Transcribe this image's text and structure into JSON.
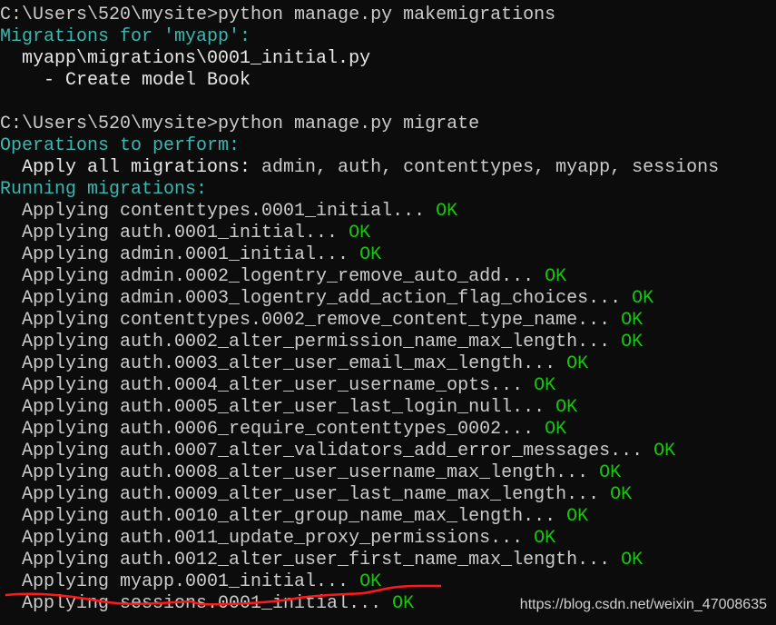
{
  "terminal": {
    "lines": [
      [
        {
          "t": "C:\\Users\\520\\mysite>python manage.py makemigrations",
          "c": "normal"
        }
      ],
      [
        {
          "t": "Migrations for 'myapp':",
          "c": "cyan"
        }
      ],
      [
        {
          "t": "  myapp\\migrations\\0001_initial.py",
          "c": "bold"
        }
      ],
      [
        {
          "t": "    - Create model Book",
          "c": "bold"
        }
      ],
      [
        {
          "t": "",
          "c": "normal"
        }
      ],
      [
        {
          "t": "C:\\Users\\520\\mysite>python manage.py migrate",
          "c": "normal"
        }
      ],
      [
        {
          "t": "Operations to perform:",
          "c": "cyan"
        }
      ],
      [
        {
          "t": "  Apply all migrations: ",
          "c": "bold"
        },
        {
          "t": "admin, auth, contenttypes, myapp, sessions",
          "c": "normal"
        }
      ],
      [
        {
          "t": "Running migrations:",
          "c": "cyan"
        }
      ],
      [
        {
          "t": "  Applying contenttypes.0001_initial... ",
          "c": "normal"
        },
        {
          "t": "OK",
          "c": "green"
        }
      ],
      [
        {
          "t": "  Applying auth.0001_initial... ",
          "c": "normal"
        },
        {
          "t": "OK",
          "c": "green"
        }
      ],
      [
        {
          "t": "  Applying admin.0001_initial... ",
          "c": "normal"
        },
        {
          "t": "OK",
          "c": "green"
        }
      ],
      [
        {
          "t": "  Applying admin.0002_logentry_remove_auto_add... ",
          "c": "normal"
        },
        {
          "t": "OK",
          "c": "green"
        }
      ],
      [
        {
          "t": "  Applying admin.0003_logentry_add_action_flag_choices... ",
          "c": "normal"
        },
        {
          "t": "OK",
          "c": "green"
        }
      ],
      [
        {
          "t": "  Applying contenttypes.0002_remove_content_type_name... ",
          "c": "normal"
        },
        {
          "t": "OK",
          "c": "green"
        }
      ],
      [
        {
          "t": "  Applying auth.0002_alter_permission_name_max_length... ",
          "c": "normal"
        },
        {
          "t": "OK",
          "c": "green"
        }
      ],
      [
        {
          "t": "  Applying auth.0003_alter_user_email_max_length... ",
          "c": "normal"
        },
        {
          "t": "OK",
          "c": "green"
        }
      ],
      [
        {
          "t": "  Applying auth.0004_alter_user_username_opts... ",
          "c": "normal"
        },
        {
          "t": "OK",
          "c": "green"
        }
      ],
      [
        {
          "t": "  Applying auth.0005_alter_user_last_login_null... ",
          "c": "normal"
        },
        {
          "t": "OK",
          "c": "green"
        }
      ],
      [
        {
          "t": "  Applying auth.0006_require_contenttypes_0002... ",
          "c": "normal"
        },
        {
          "t": "OK",
          "c": "green"
        }
      ],
      [
        {
          "t": "  Applying auth.0007_alter_validators_add_error_messages... ",
          "c": "normal"
        },
        {
          "t": "OK",
          "c": "green"
        }
      ],
      [
        {
          "t": "  Applying auth.0008_alter_user_username_max_length... ",
          "c": "normal"
        },
        {
          "t": "OK",
          "c": "green"
        }
      ],
      [
        {
          "t": "  Applying auth.0009_alter_user_last_name_max_length... ",
          "c": "normal"
        },
        {
          "t": "OK",
          "c": "green"
        }
      ],
      [
        {
          "t": "  Applying auth.0010_alter_group_name_max_length... ",
          "c": "normal"
        },
        {
          "t": "OK",
          "c": "green"
        }
      ],
      [
        {
          "t": "  Applying auth.0011_update_proxy_permissions... ",
          "c": "normal"
        },
        {
          "t": "OK",
          "c": "green"
        }
      ],
      [
        {
          "t": "  Applying auth.0012_alter_user_first_name_max_length... ",
          "c": "normal"
        },
        {
          "t": "OK",
          "c": "green"
        }
      ],
      [
        {
          "t": "  Applying myapp.0001_initial... ",
          "c": "normal"
        },
        {
          "t": "OK",
          "c": "green"
        }
      ],
      [
        {
          "t": "  Applying sessions.0001_initial... ",
          "c": "normal"
        },
        {
          "t": "OK",
          "c": "green"
        }
      ]
    ]
  },
  "watermark": "https://blog.csdn.net/weixin_47008635",
  "colors": {
    "background": "#0c0c0c",
    "text": "#cccccc",
    "cyan": "#3ab8b0",
    "green": "#16c60c",
    "annotation": "#ff1a1a"
  }
}
